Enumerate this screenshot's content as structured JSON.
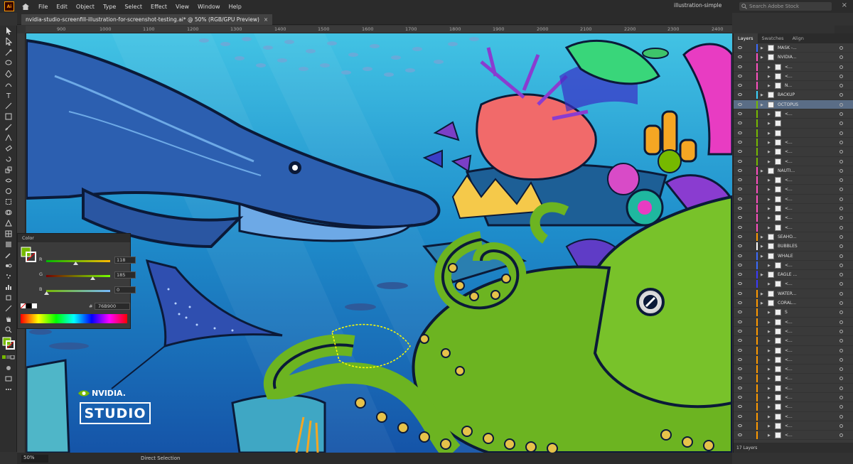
{
  "app": {
    "logo": "Ai",
    "workspace": "illustration-simple",
    "search_placeholder": "Search Adobe Stock"
  },
  "menu": [
    "File",
    "Edit",
    "Object",
    "Type",
    "Select",
    "Effect",
    "View",
    "Window",
    "Help"
  ],
  "document": {
    "tab_title": "nvidia-studio-screenfill-illustration-for-screenshot-testing.ai* @ 50% (RGB/GPU Preview)"
  },
  "ruler": [
    "900",
    "1000",
    "1100",
    "1200",
    "1300",
    "1400",
    "1500",
    "1600",
    "1700",
    "1800",
    "1900",
    "2000",
    "2100",
    "2200",
    "2300",
    "2400",
    "2500"
  ],
  "color_panel": {
    "title": "Color",
    "channels": [
      {
        "label": "R",
        "value": "118",
        "fraction": 0.46
      },
      {
        "label": "G",
        "value": "185",
        "fraction": 0.73
      },
      {
        "label": "B",
        "value": "0",
        "fraction": 0.0
      }
    ],
    "hash": "#",
    "hex": "76B900"
  },
  "layers_panel": {
    "tabs": [
      "Layers",
      "Swatches",
      "Align"
    ],
    "rows": [
      {
        "name": "MASK -...",
        "color": "#3b6bff"
      },
      {
        "name": "NVIDIA...",
        "color": "#ff4fc0"
      },
      {
        "name": "<...",
        "color": "#ff4fc0"
      },
      {
        "name": "<...",
        "color": "#ff4fc0"
      },
      {
        "name": "N...",
        "color": "#ff4fc0"
      },
      {
        "name": "BACKUP",
        "color": "#3bd4ff"
      },
      {
        "name": "OCTOPUS",
        "color": "#76b900"
      },
      {
        "name": "<...",
        "color": "#76b900"
      },
      {
        "name": "",
        "color": "#76b900"
      },
      {
        "name": "",
        "color": "#76b900"
      },
      {
        "name": "<...",
        "color": "#76b900"
      },
      {
        "name": "<...",
        "color": "#76b900"
      },
      {
        "name": "<...",
        "color": "#76b900"
      },
      {
        "name": "NAUTI...",
        "color": "#ff4fc0"
      },
      {
        "name": "<...",
        "color": "#ff4fc0"
      },
      {
        "name": "<...",
        "color": "#ff4fc0"
      },
      {
        "name": "<...",
        "color": "#ff4fc0"
      },
      {
        "name": "<...",
        "color": "#ff4fc0"
      },
      {
        "name": "<...",
        "color": "#ff4fc0"
      },
      {
        "name": "<...",
        "color": "#ff4fc0"
      },
      {
        "name": "SEAHO...",
        "color": "#ff9a00"
      },
      {
        "name": "BUBBLES",
        "color": "#ffffff"
      },
      {
        "name": "WHALE",
        "color": "#3b6bff"
      },
      {
        "name": "<...",
        "color": "#3b6bff"
      },
      {
        "name": "EAGLE ...",
        "color": "#3b3bff"
      },
      {
        "name": "<...",
        "color": "#3b3bff"
      },
      {
        "name": "WATER...",
        "color": "#ff9a00"
      },
      {
        "name": "CORAL...",
        "color": "#ff9a00"
      },
      {
        "name": "S",
        "color": "#ff9a00"
      },
      {
        "name": "<...",
        "color": "#ff9a00"
      },
      {
        "name": "<...",
        "color": "#ff9a00"
      },
      {
        "name": "<...",
        "color": "#ff9a00"
      },
      {
        "name": "<...",
        "color": "#ff9a00"
      },
      {
        "name": "<...",
        "color": "#ff9a00"
      },
      {
        "name": "<...",
        "color": "#ff9a00"
      },
      {
        "name": "<...",
        "color": "#ff9a00"
      },
      {
        "name": "<...",
        "color": "#ff9a00"
      },
      {
        "name": "<...",
        "color": "#ff9a00"
      },
      {
        "name": "<...",
        "color": "#ff9a00"
      },
      {
        "name": "<...",
        "color": "#ff9a00"
      },
      {
        "name": "<...",
        "color": "#ff9a00"
      },
      {
        "name": "<...",
        "color": "#ff9a00"
      }
    ],
    "footer": "17 Layers"
  },
  "status": {
    "zoom": "50%",
    "mode": "Direct Selection"
  },
  "artwork_logo": {
    "brand": "NVIDIA.",
    "product": "STUDIO"
  },
  "colors": {
    "accent": "#76b900",
    "selection": "#5a6d86"
  }
}
